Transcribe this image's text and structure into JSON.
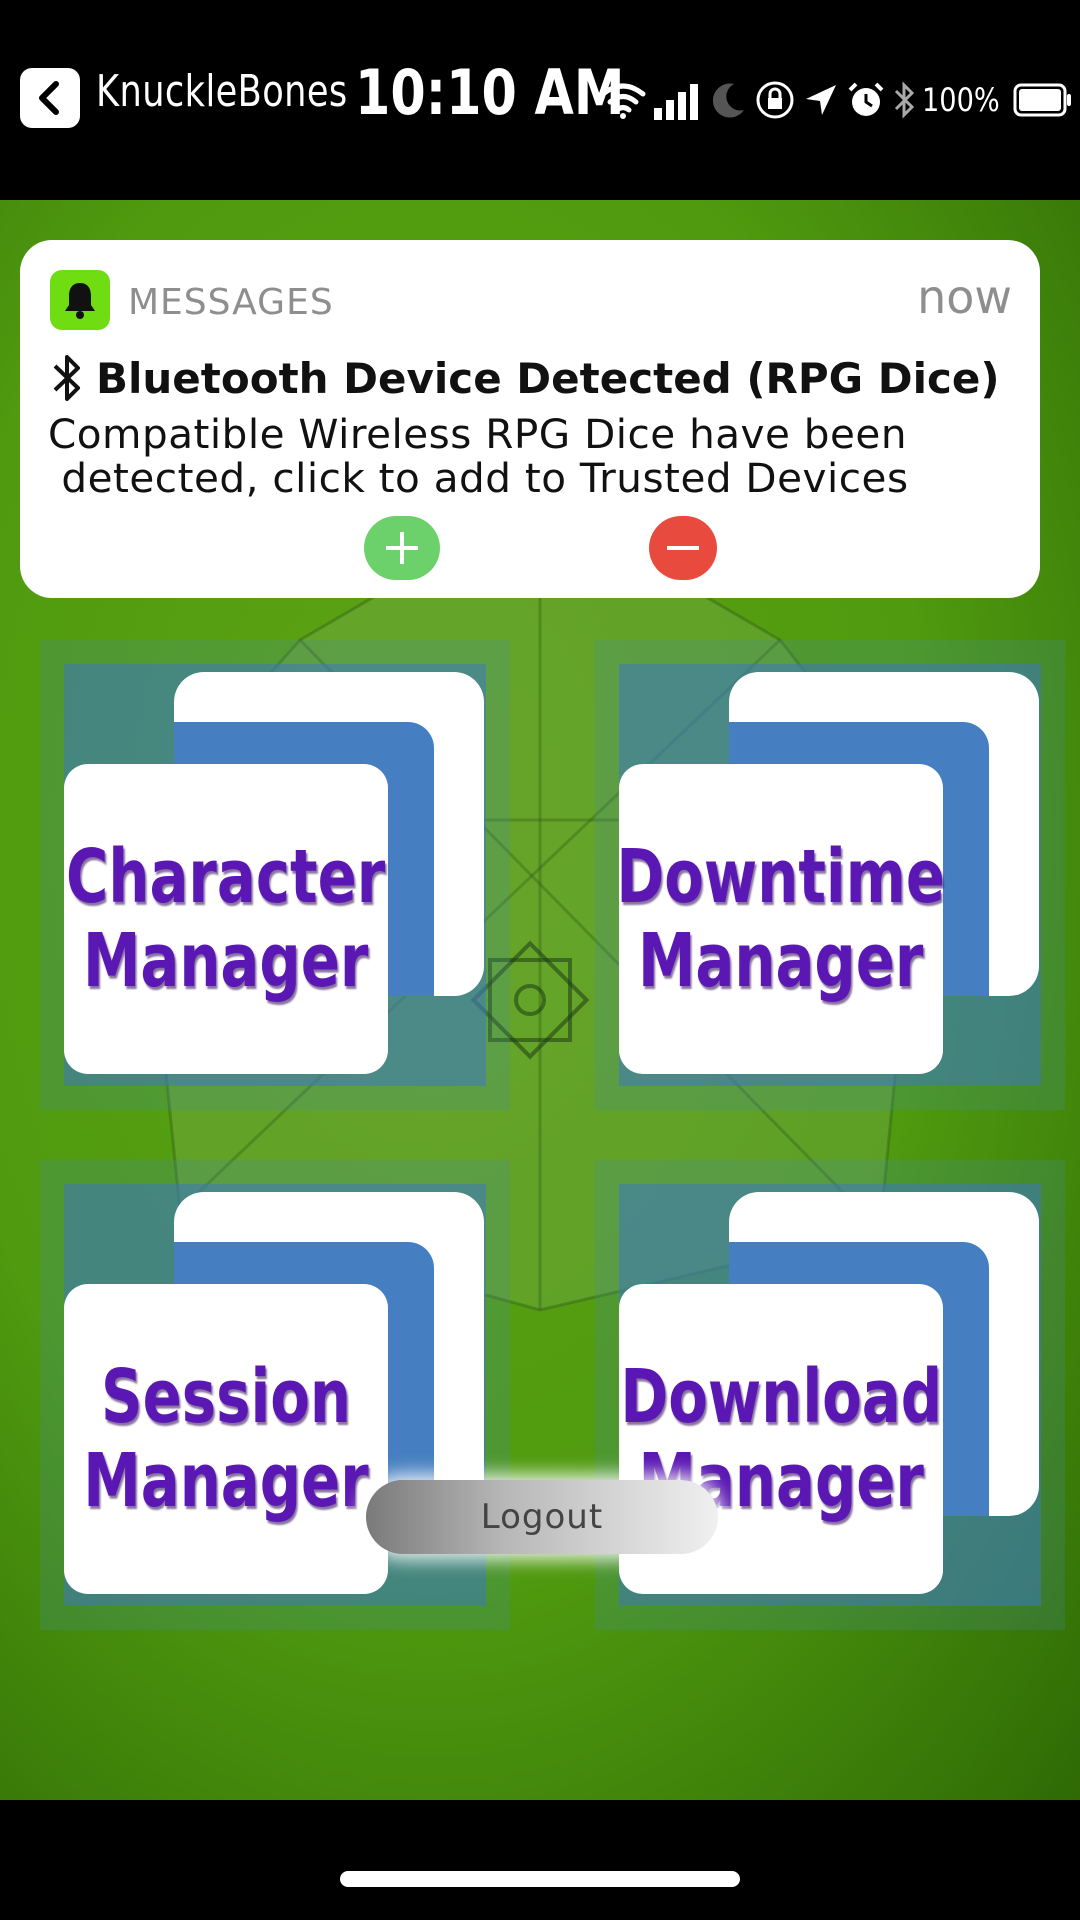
{
  "status_bar": {
    "app_name": "KnuckleBones",
    "time": "10:10 AM",
    "battery_percent": "100%",
    "icons": [
      "back-icon",
      "wifi-icon",
      "signal-icon",
      "moon-icon",
      "rotation-lock-icon",
      "location-arrow-icon",
      "alarm-icon",
      "bluetooth-icon",
      "battery-icon"
    ]
  },
  "notification": {
    "app_name": "MESSAGES",
    "time": "now",
    "title": "Bluetooth Device Detected (RPG Dice)",
    "body": "Compatible Wireless RPG Dice have been\n detected, click to add to Trusted Devices",
    "icons": [
      "bell-icon",
      "bluetooth-icon",
      "plus-icon",
      "minus-icon"
    ],
    "accept_color": "#6cd16a",
    "decline_color": "#e94a3e"
  },
  "tiles": [
    {
      "label": "Character\nManager"
    },
    {
      "label": "Downtime\nManager"
    },
    {
      "label": " Session \nManager"
    },
    {
      "label": "Download\nManager"
    }
  ],
  "logout": {
    "label": "Logout"
  },
  "colors": {
    "background_green": "#4f9a0f",
    "tile_label_purple": "#5a17b3",
    "tile_blue": "#3c78be"
  }
}
